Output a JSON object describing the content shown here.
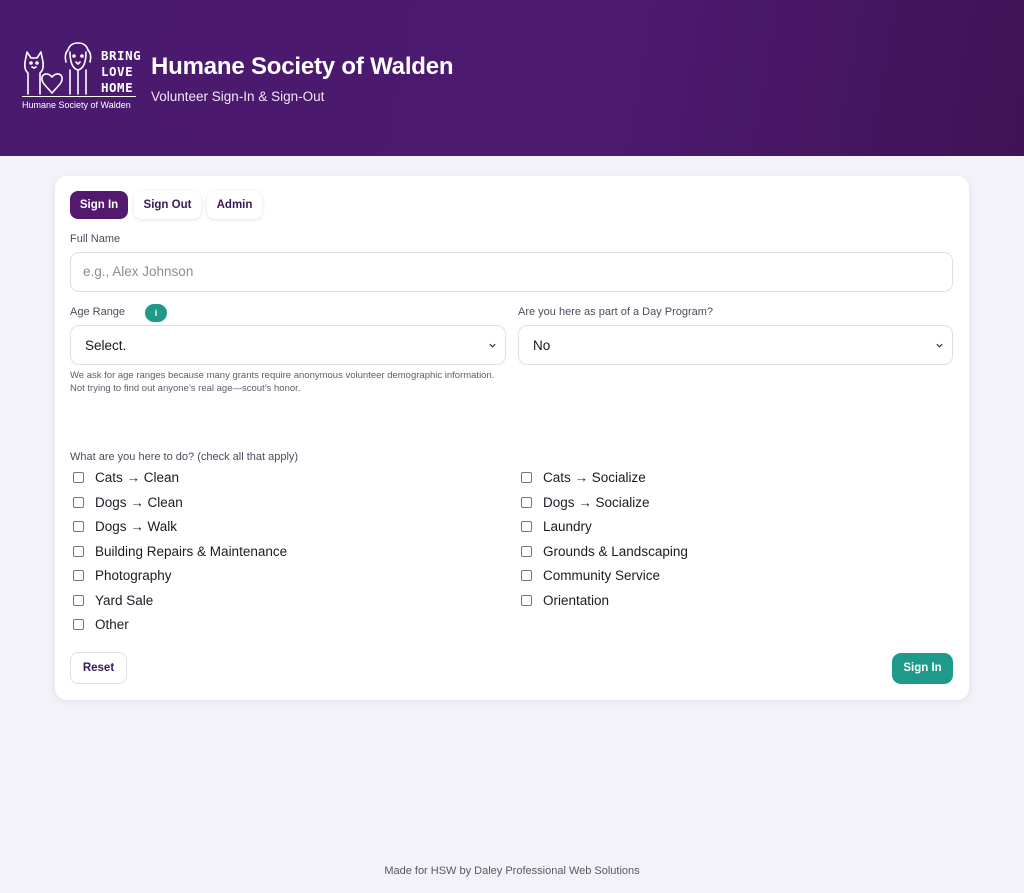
{
  "header": {
    "logo": {
      "words": [
        "BRING",
        "LOVE",
        "HOME"
      ],
      "caption": "Humane Society of Walden"
    },
    "title": "Humane Society of Walden",
    "subtitle": "Volunteer Sign-In & Sign-Out"
  },
  "tabs": [
    {
      "label": "Sign In",
      "active": true
    },
    {
      "label": "Sign Out",
      "active": false
    },
    {
      "label": "Admin",
      "active": false
    }
  ],
  "form": {
    "full_name": {
      "label": "Full Name",
      "value": "",
      "placeholder": "e.g., Alex Johnson"
    },
    "age_range": {
      "label": "Age Range",
      "info_icon": "i",
      "selected": "Select.",
      "help": "We ask for age ranges because many grants require anonymous volunteer demographic information. Not trying to find out anyone’s real age—scout’s honor."
    },
    "day_program": {
      "label": "Are you here as part of a Day Program?",
      "selected": "No"
    },
    "activities": {
      "label": "What are you here to do? (check all that apply)",
      "left": [
        {
          "label": "Cats → Clean",
          "checked": false
        },
        {
          "label": "Dogs → Clean",
          "checked": false
        },
        {
          "label": "Dogs → Walk",
          "checked": false
        },
        {
          "label": "Building Repairs & Maintenance",
          "checked": false
        },
        {
          "label": "Photography",
          "checked": false
        },
        {
          "label": "Yard Sale",
          "checked": false
        },
        {
          "label": "Other",
          "checked": false
        }
      ],
      "right": [
        {
          "label": "Cats → Socialize",
          "checked": false
        },
        {
          "label": "Dogs → Socialize",
          "checked": false
        },
        {
          "label": "Laundry",
          "checked": false
        },
        {
          "label": "Grounds & Landscaping",
          "checked": false
        },
        {
          "label": "Community Service",
          "checked": false
        },
        {
          "label": "Orientation",
          "checked": false
        }
      ]
    },
    "reset_label": "Reset",
    "submit_label": "Sign In"
  },
  "footer": "Made for HSW by Daley Professional Web Solutions",
  "colors": {
    "brand_purple": "#4a1a6e",
    "accent_teal": "#1f9a8a",
    "background": "#f3f2f8"
  }
}
